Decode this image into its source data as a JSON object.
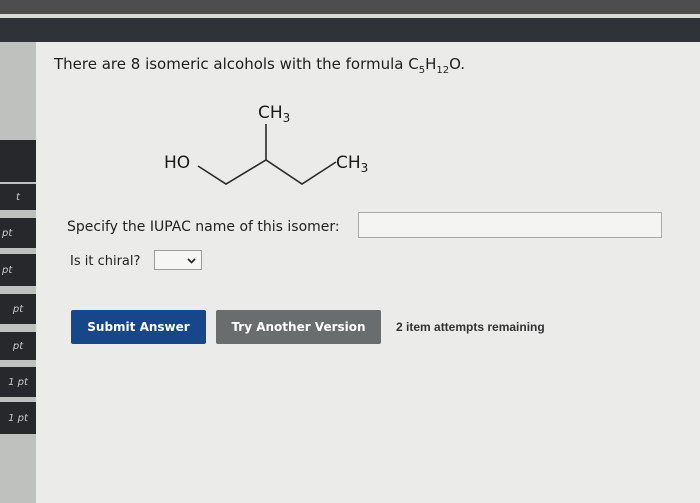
{
  "question": {
    "text_before": "There are 8 isomeric alcohols with the formula C",
    "sub5": "5",
    "h": "H",
    "sub12": "12",
    "o": "O."
  },
  "structure": {
    "top_group": "CH3",
    "left_group": "HO",
    "right_group": "CH3"
  },
  "form": {
    "specify_label": "Specify the IUPAC name of this isomer:",
    "answer_value": "",
    "chiral_label": "Is it chiral?",
    "chiral_value": ""
  },
  "buttons": {
    "submit_label": "Submit Answer",
    "try_label": "Try Another Version"
  },
  "attempts_text": "2 item attempts remaining",
  "sidebar": {
    "tabs": [
      "t",
      "pt",
      "pt",
      "pt",
      "pt",
      "1 pt",
      "1 pt"
    ]
  }
}
